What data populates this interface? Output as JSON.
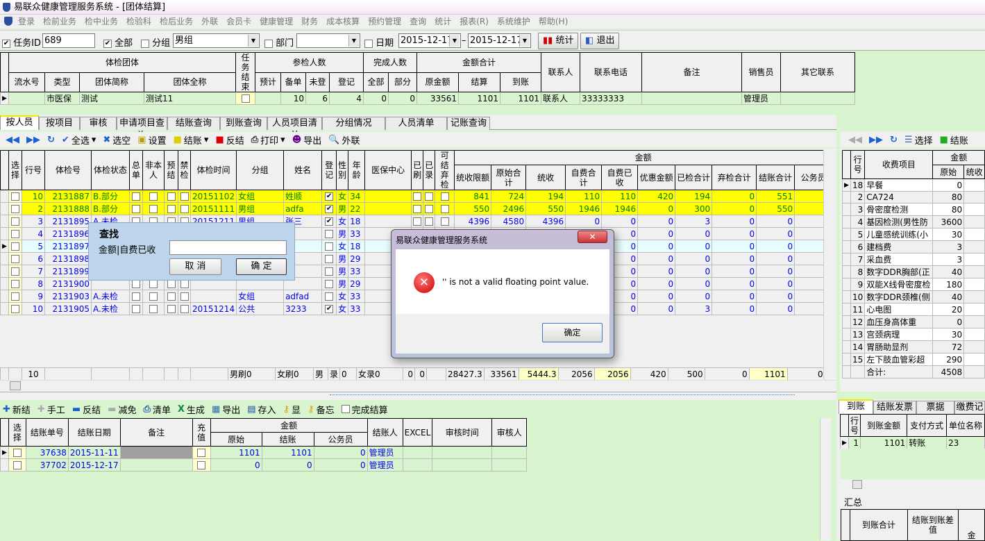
{
  "window": {
    "title": "易联众健康管理服务系统 - [团体结算]"
  },
  "menu": [
    "登录",
    "检前业务",
    "检中业务",
    "检验科",
    "检后业务",
    "外联",
    "会员卡",
    "健康管理",
    "财务",
    "成本核算",
    "预约管理",
    "查询",
    "统计",
    "报表(R)",
    "系统维护",
    "帮助(H)"
  ],
  "filter": {
    "task_id_label": "任务ID",
    "task_id_checked": true,
    "task_id": "689",
    "all_label": "全部",
    "all_checked": true,
    "group_label": "分组",
    "group_checked": false,
    "group_value": "男组",
    "dept_label": "部门",
    "dept_checked": false,
    "dept_value": "",
    "date_label": "日期",
    "date_checked": false,
    "date_from": "2015-12-17",
    "date_sep": "–",
    "date_to": "2015-12-17",
    "stats_button": "统计",
    "exit_button": "退出"
  },
  "group_grid": {
    "headers": {
      "team": "体检团体",
      "serial": "流水号",
      "type": "类型",
      "short": "团体简称",
      "full": "团体全称",
      "task_end": "任务结束",
      "participants": "参检人数",
      "planned": "预计",
      "prepared": "备单",
      "unregistered": "未登",
      "registered": "登记",
      "completed": "完成人数",
      "all": "全部",
      "partial": "部分",
      "amount_total": "金额合计",
      "original": "原金额",
      "settled": "结算",
      "received": "到账",
      "contact": "联系人",
      "phone": "联系电话",
      "remark": "备注",
      "sales": "销售员",
      "other": "其它联系"
    },
    "rows": [
      {
        "serial": "",
        "type": "市医保",
        "short": "测试",
        "full": "测试11",
        "task_end": false,
        "planned": "",
        "prepared": "10",
        "unregistered": "6",
        "registered": "4",
        "all": "0",
        "partial": "0",
        "original": "33561",
        "settled": "1101",
        "received": "1101",
        "contact": "联系人",
        "phone": "33333333",
        "remark": "",
        "sales": "管理员",
        "other": ""
      }
    ]
  },
  "tabs": [
    "按人员",
    "按项目",
    "审核",
    "申请项目查询",
    "结账查询",
    "到账查询",
    "人员项目清单",
    "分组情况",
    "人员清单",
    "记账查询"
  ],
  "person_toolbar": {
    "select_all": "全选",
    "clear": "选空",
    "settings": "设置",
    "settle": "结账",
    "unsettle": "反结",
    "print": "打印",
    "export": "导出",
    "outreach": "外联"
  },
  "person_grid": {
    "headers": {
      "select": "选择",
      "row": "行号",
      "exam_no": "体检号",
      "status": "体检状态",
      "total_bill": "总单",
      "not_self": "非本人",
      "pre_settle": "预结",
      "banned": "禁检",
      "exam_time": "体检时间",
      "group": "分组",
      "name": "姓名",
      "registered": "登记",
      "gender": "性别",
      "age": "年龄",
      "insurance": "医保中心",
      "swiped": "已刷",
      "recorded": "已录",
      "can_abandon": "可结弃检",
      "amount": "金额",
      "limit": "统收限额",
      "orig_total": "原始合计",
      "unified": "统收",
      "self_total": "自费合计",
      "self_paid": "自费已收",
      "discount": "优惠金额",
      "checked_total": "已检合计",
      "abandoned_total": "弃检合计",
      "settled_total": "结账合计",
      "civil": "公务员"
    },
    "rows": [
      {
        "hl": "yellow",
        "row": "10",
        "exam_no": "2131887",
        "status": "B.部分",
        "time": "20151102",
        "group": "女组",
        "name": "姓顺",
        "reg": true,
        "gender": "女",
        "age": "34",
        "v": [
          "841",
          "724",
          "194",
          "110",
          "110",
          "420",
          "194",
          "0",
          "551",
          "0"
        ]
      },
      {
        "hl": "yellow",
        "row": "2",
        "exam_no": "2131888",
        "status": "B.部分",
        "time": "20151111",
        "group": "男组",
        "name": "adfa",
        "reg": true,
        "gender": "男",
        "age": "22",
        "v": [
          "550",
          "2496",
          "550",
          "1946",
          "1946",
          "0",
          "300",
          "0",
          "550",
          "0"
        ]
      },
      {
        "hl": "",
        "row": "3",
        "exam_no": "2131895",
        "status": "A.未检",
        "time": "20151211",
        "group": "男组",
        "name": "张三",
        "reg": true,
        "gender": "女",
        "age": "18",
        "v": [
          "4396",
          "4580",
          "4396",
          "0",
          "0",
          "0",
          "3",
          "0",
          "0",
          "0"
        ]
      },
      {
        "hl": "",
        "row": "4",
        "exam_no": "2131896",
        "status": "",
        "time": "",
        "group": "",
        "name": "",
        "reg": false,
        "gender": "男",
        "age": "33",
        "v": [
          "",
          "",
          "",
          "",
          "0",
          "0",
          "0",
          "0",
          "0",
          "0"
        ]
      },
      {
        "hl": "current",
        "row": "5",
        "exam_no": "2131897",
        "status": "",
        "time": "",
        "group": "",
        "name": "",
        "reg": false,
        "gender": "女",
        "age": "18",
        "v": [
          "",
          "",
          "",
          "",
          "0",
          "0",
          "0",
          "0",
          "0",
          "0"
        ]
      },
      {
        "hl": "",
        "row": "6",
        "exam_no": "2131898",
        "status": "",
        "time": "",
        "group": "",
        "name": "",
        "reg": false,
        "gender": "男",
        "age": "29",
        "v": [
          "",
          "",
          "",
          "",
          "0",
          "0",
          "0",
          "0",
          "0",
          "0"
        ]
      },
      {
        "hl": "",
        "row": "7",
        "exam_no": "2131899",
        "status": "",
        "time": "",
        "group": "",
        "name": "",
        "reg": false,
        "gender": "男",
        "age": "33",
        "v": [
          "",
          "",
          "",
          "",
          "0",
          "0",
          "0",
          "0",
          "0",
          "0"
        ]
      },
      {
        "hl": "",
        "row": "8",
        "exam_no": "2131900",
        "status": "",
        "time": "",
        "group": "",
        "name": "",
        "reg": false,
        "gender": "男",
        "age": "29",
        "v": [
          "",
          "",
          "",
          "",
          "0",
          "0",
          "0",
          "0",
          "0",
          "0"
        ]
      },
      {
        "hl": "",
        "row": "9",
        "exam_no": "2131903",
        "status": "A.未检",
        "time": "",
        "group": "女组",
        "name": "adfad",
        "reg": false,
        "gender": "女",
        "age": "33",
        "v": [
          "",
          "",
          "",
          "",
          "0",
          "0",
          "0",
          "0",
          "0",
          "0"
        ]
      },
      {
        "hl": "",
        "row": "10",
        "exam_no": "2131905",
        "status": "A.未检",
        "time": "20151214",
        "group": "公共",
        "name": "3233",
        "reg": true,
        "gender": "女",
        "age": "33",
        "v": [
          "",
          "",
          "",
          "",
          "0",
          "0",
          "3",
          "0",
          "0",
          "0"
        ]
      }
    ],
    "summary": {
      "count": "10",
      "male_swiped": "男刷0",
      "female_swiped": "女刷0",
      "male": "男",
      "rec": "录",
      "zero": "0",
      "female_rec": "女录0",
      "swiped": "0",
      "recorded": "0",
      "v": [
        "28427.3",
        "33561",
        "5444.3",
        "2056",
        "2056",
        "420",
        "500",
        "0",
        "1101",
        "0"
      ]
    }
  },
  "item_panel": {
    "select": "选择",
    "settle": "结账",
    "headers": {
      "row": "行号",
      "item": "收费项目",
      "amount": "金额",
      "original": "原始",
      "unified": "统收"
    },
    "rows": [
      [
        "18",
        "早餐",
        "0"
      ],
      [
        "2",
        "CA724",
        "80"
      ],
      [
        "3",
        "骨密度检测",
        "80"
      ],
      [
        "4",
        "基因检测(男性防",
        "3600"
      ],
      [
        "5",
        "儿童感统训练(小",
        "30"
      ],
      [
        "6",
        "建档费",
        "3"
      ],
      [
        "7",
        "采血费",
        "3"
      ],
      [
        "8",
        "数字DDR胸部(正",
        "40"
      ],
      [
        "9",
        "双能X线骨密度检",
        "180"
      ],
      [
        "10",
        "数字DDR颈椎(侧",
        "40"
      ],
      [
        "11",
        "心电图",
        "20"
      ],
      [
        "12",
        "血压身高体重",
        "0"
      ],
      [
        "13",
        "宫颈病理",
        "30"
      ],
      [
        "14",
        "胃肠助显剂",
        "72"
      ],
      [
        "15",
        "左下肢血管彩超",
        "290"
      ]
    ],
    "total_label": "合计:",
    "total": "4508"
  },
  "settle_toolbar": {
    "new": "新结",
    "manual": "手工",
    "unsettle": "反结",
    "waive": "减免",
    "list": "清单",
    "generate": "生成",
    "export": "导出",
    "save": "存入",
    "show": "显",
    "memo": "备忘",
    "complete": "完成结算"
  },
  "settle_grid": {
    "headers": {
      "select": "选择",
      "bill_no": "结账单号",
      "date": "结账日期",
      "remark": "备注",
      "recharge": "充值",
      "amount": "金额",
      "original": "原始",
      "settled": "结账",
      "civil": "公务员",
      "operator": "结账人",
      "excel": "EXCEL",
      "audit_time": "审核时间",
      "auditor": "审核人"
    },
    "rows": [
      {
        "bill_no": "37638",
        "date": "2015-11-11",
        "original": "1101",
        "settled": "1101",
        "civil": "0",
        "operator": "管理员"
      },
      {
        "bill_no": "37702",
        "date": "2015-12-17",
        "original": "0",
        "settled": "0",
        "civil": "0",
        "operator": "管理员"
      }
    ]
  },
  "receipt_panel": {
    "tabs": [
      "到账",
      "结账发票",
      "票据",
      "缴费记"
    ],
    "headers": {
      "row": "行号",
      "amount": "到账金额",
      "method": "支付方式",
      "unit": "单位名称"
    },
    "rows": [
      {
        "row": "1",
        "amount": "1101",
        "method": "转账",
        "unit": "23"
      }
    ],
    "summary_title": "汇总",
    "summary_headers": {
      "total": "到账合计",
      "diff": "结账到账差值",
      "amount": "金"
    }
  },
  "find_dialog": {
    "title": "查找",
    "label": "金额|自费已收",
    "value": "",
    "cancel": "取 消",
    "ok": "确 定"
  },
  "error_dialog": {
    "title": "易联众健康管理服务系统",
    "message": "'' is not a valid floating point value.",
    "ok": "确定"
  },
  "colors": {
    "yellow_row": "#ffff00",
    "current_row": "#e8fdfd",
    "green_bg": "#d9f5cf",
    "blue_text": "#0000ee",
    "green_text": "#008000"
  }
}
